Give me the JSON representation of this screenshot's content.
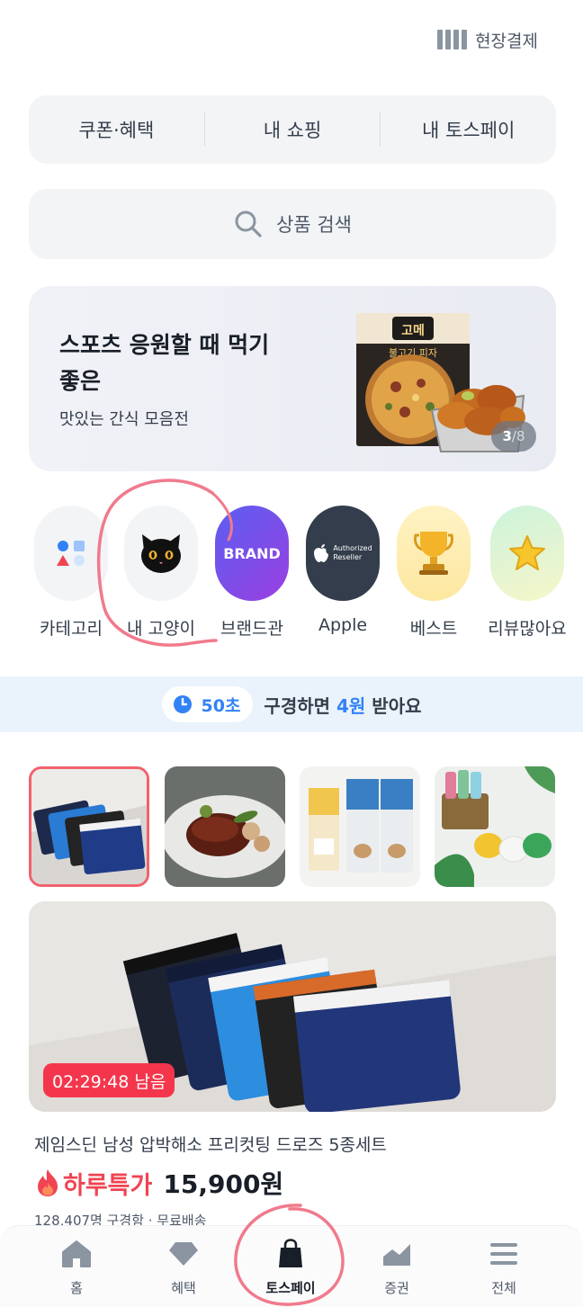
{
  "header": {
    "pay_onsite_label": "현장결제"
  },
  "top_tabs": [
    {
      "label": "쿠폰·혜택"
    },
    {
      "label": "내 쇼핑"
    },
    {
      "label": "내 토스페이"
    }
  ],
  "search": {
    "placeholder": "상품 검색"
  },
  "banner": {
    "title": "스포츠 응원할 때 먹기 좋은",
    "subtitle": "맛있는 간식 모음전",
    "page_current": "3",
    "page_total": "/8",
    "package_brand": "고메",
    "package_name": "불고기 피자"
  },
  "shortcuts": [
    {
      "label": "카테고리",
      "icon": "category-grid-icon"
    },
    {
      "label": "내 고양이",
      "icon": "black-cat-icon"
    },
    {
      "label": "브랜드관",
      "icon": "brand-badge-icon",
      "badge_text": "BRAND"
    },
    {
      "label": "Apple",
      "icon": "apple-logo-icon",
      "badge_text_1": "Authorized",
      "badge_text_2": "Reseller"
    },
    {
      "label": "베스트",
      "icon": "trophy-icon"
    },
    {
      "label": "리뷰많아요",
      "icon": "star-icon"
    }
  ],
  "reward": {
    "timer": "50초",
    "text_before": "구경하면 ",
    "amount": "4원",
    "text_after": " 받아요"
  },
  "product": {
    "countdown": "02:29:48 남음",
    "name": "제임스딘 남성 압박해소 프리컷팅 드로즈 5종세트",
    "deal_label": "하루특가",
    "price": "15,900원",
    "meta": "128,407명 구경함 · 무료배송"
  },
  "bottom_nav": [
    {
      "label": "홈",
      "icon": "home-icon"
    },
    {
      "label": "혜택",
      "icon": "diamond-icon"
    },
    {
      "label": "토스페이",
      "icon": "shopping-bag-icon",
      "active": true
    },
    {
      "label": "증권",
      "icon": "stock-chart-icon"
    },
    {
      "label": "전체",
      "icon": "menu-icon"
    }
  ],
  "colors": {
    "accent_blue": "#3182f6",
    "deal_red": "#f04452",
    "annotation_pink": "#f07a8c"
  }
}
